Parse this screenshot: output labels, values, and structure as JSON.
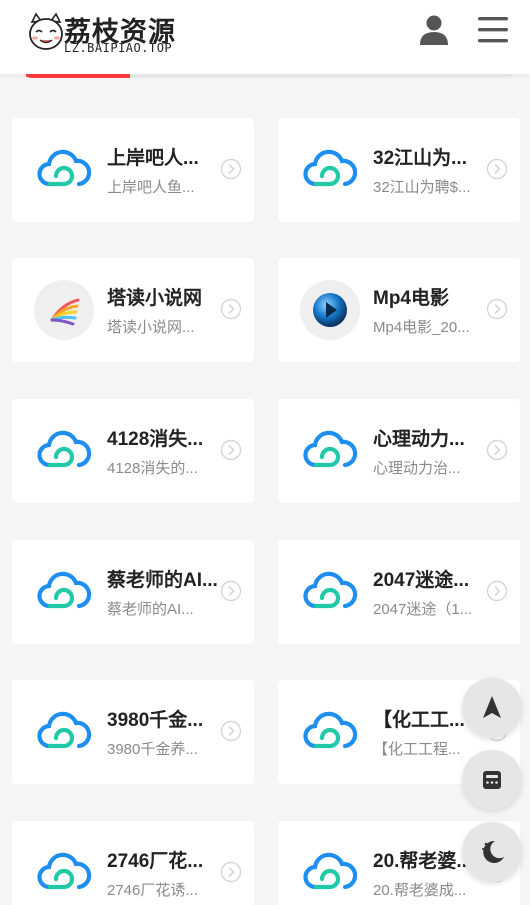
{
  "header": {
    "logo_title": "荔枝资源",
    "logo_sub": "LZ.BAIPIAO.TOP"
  },
  "colors": {
    "accent_red": "#ff3b3b",
    "cloud_blue": "#1e8ff0",
    "cloud_green": "#22c9a6"
  },
  "cards": [
    {
      "title": "上岸吧人...",
      "desc": "上岸吧人鱼...",
      "icon": "cloud-icon"
    },
    {
      "title": "32江山为...",
      "desc": "32江山为聘$...",
      "icon": "cloud-icon"
    },
    {
      "title": "塔读小说网",
      "desc": "塔读小说网...",
      "icon": "tadu-logo-icon"
    },
    {
      "title": "Mp4电影",
      "desc": "Mp4电影_20...",
      "icon": "mp4-play-icon"
    },
    {
      "title": "4128消失...",
      "desc": "4128消失的...",
      "icon": "cloud-icon"
    },
    {
      "title": "心理动力...",
      "desc": "心理动力治...",
      "icon": "cloud-icon"
    },
    {
      "title": "蔡老师的AI...",
      "desc": "蔡老师的AI...",
      "icon": "cloud-icon"
    },
    {
      "title": "2047迷途...",
      "desc": "2047迷途（1...",
      "icon": "cloud-icon"
    },
    {
      "title": "3980千金...",
      "desc": "3980千金养...",
      "icon": "cloud-icon"
    },
    {
      "title": "【化工工...",
      "desc": "【化工工程...",
      "icon": "cloud-icon"
    },
    {
      "title": "2746厂花...",
      "desc": "2746厂花诱...",
      "icon": "cloud-icon"
    },
    {
      "title": "20.帮老婆...",
      "desc": "20.帮老婆成...",
      "icon": "cloud-icon"
    }
  ],
  "floating_buttons": [
    "back-to-top-icon",
    "calculator-icon",
    "night-mode-icon"
  ]
}
